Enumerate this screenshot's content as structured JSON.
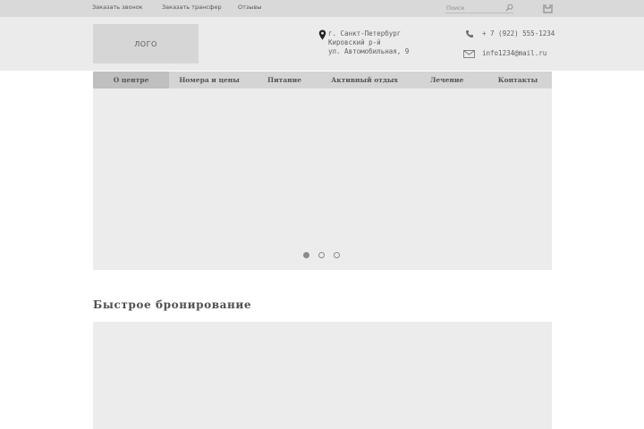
{
  "topbar": {
    "links": [
      "Заказать звонок",
      "Заказать трансфер",
      "Отзывы"
    ],
    "search_placeholder": "Поиск"
  },
  "header": {
    "logo_text": "ЛОГО",
    "address_lines": [
      "г. Санкт-Петербург",
      "Кировский р-й",
      "ул. Автомобильная, 9"
    ],
    "phone": "+ 7 (922) 555-1234",
    "email": "info1234@mail.ru"
  },
  "nav": {
    "items": [
      "О центре",
      "Номера и цены",
      "Питание",
      "Активный отдых",
      "Лечение",
      "Контакты"
    ],
    "active_index": 0
  },
  "slider": {
    "slide_count": 3,
    "active_index": 0
  },
  "booking": {
    "title": "Быстрое бронирование"
  },
  "colors": {
    "topbar_bg": "#d9d9d9",
    "header_bg": "#ebebeb",
    "nav_bg": "#d4d4d4",
    "nav_active_bg": "#bfbfbf",
    "panel_bg": "#ececec"
  },
  "icons": [
    "search-icon",
    "cart-icon",
    "map-pin-icon",
    "phone-icon",
    "mail-icon"
  ]
}
